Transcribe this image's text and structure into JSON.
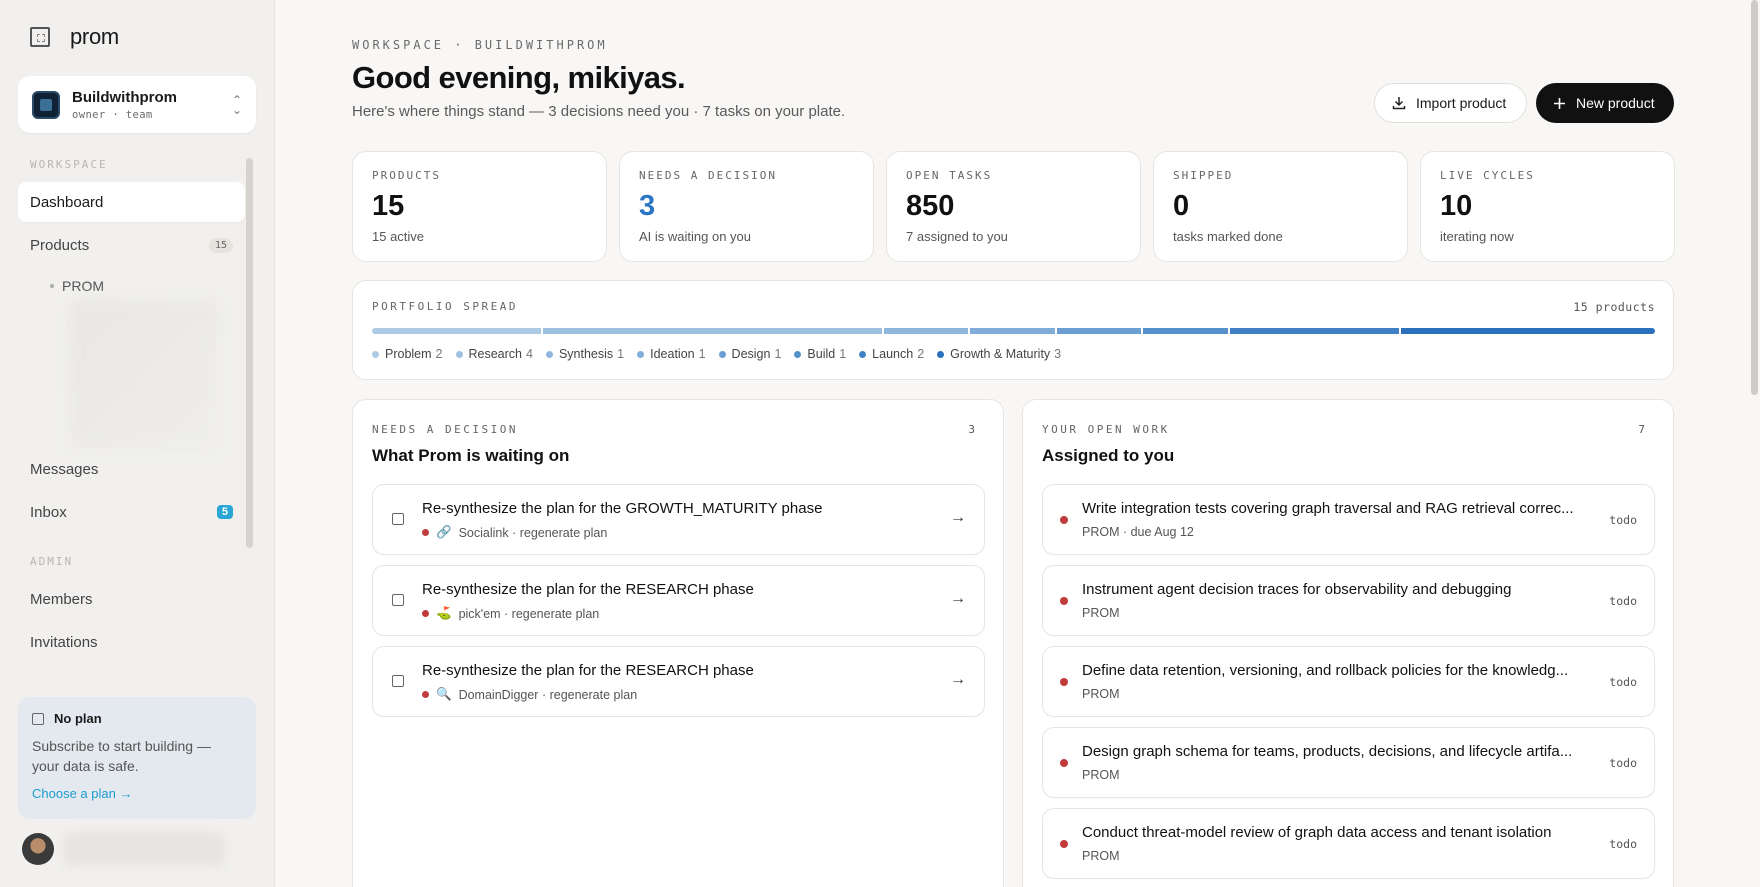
{
  "brand": {
    "name": "prom"
  },
  "workspace": {
    "name": "Buildwithprom",
    "role": "owner · team"
  },
  "sidebar": {
    "section_workspace": "WORKSPACE",
    "dashboard": "Dashboard",
    "products": {
      "label": "Products",
      "count": "15"
    },
    "product_item": "PROM",
    "messages": "Messages",
    "inbox": {
      "label": "Inbox",
      "badge": "5"
    },
    "section_admin": "ADMIN",
    "members": "Members",
    "invitations": "Invitations"
  },
  "plan": {
    "title": "No plan",
    "desc": "Subscribe to start building — your data is safe.",
    "link": "Choose a plan →"
  },
  "header": {
    "eyebrow": "WORKSPACE · BUILDWITHPROM",
    "greeting": "Good evening, mikiyas.",
    "subline": "Here's where things stand — 3 decisions need you · 7 tasks on your plate.",
    "import_label": "Import product",
    "new_label": "New product"
  },
  "stats": [
    {
      "label": "PRODUCTS",
      "value": "15",
      "sub": "15 active"
    },
    {
      "label": "NEEDS A DECISION",
      "value": "3",
      "sub": "AI is waiting on you"
    },
    {
      "label": "OPEN TASKS",
      "value": "850",
      "sub": "7 assigned to you"
    },
    {
      "label": "SHIPPED",
      "value": "0",
      "sub": "tasks marked done"
    },
    {
      "label": "LIVE CYCLES",
      "value": "10",
      "sub": "iterating now"
    }
  ],
  "portfolio": {
    "title": "PORTFOLIO SPREAD",
    "count": "15 products",
    "phases": [
      {
        "name": "Problem",
        "count": 2,
        "color": "#aecbe5"
      },
      {
        "name": "Research",
        "count": 4,
        "color": "#9ec0e0"
      },
      {
        "name": "Synthesis",
        "count": 1,
        "color": "#8fb6dd"
      },
      {
        "name": "Ideation",
        "count": 1,
        "color": "#7facd8"
      },
      {
        "name": "Design",
        "count": 1,
        "color": "#6b9fd2"
      },
      {
        "name": "Build",
        "count": 1,
        "color": "#5590cb"
      },
      {
        "name": "Launch",
        "count": 2,
        "color": "#3f81c4"
      },
      {
        "name": "Growth & Maturity",
        "count": 3,
        "color": "#2a70bd"
      }
    ]
  },
  "decisions": {
    "eyebrow": "NEEDS A DECISION",
    "count": "3",
    "title": "What Prom is waiting on",
    "items": [
      {
        "title": "Re-synthesize the plan for the GROWTH_MATURITY phase",
        "emoji": "🔗",
        "meta": "Socialink · regenerate plan"
      },
      {
        "title": "Re-synthesize the plan for the RESEARCH phase",
        "emoji": "⛳",
        "meta": "pick'em · regenerate plan"
      },
      {
        "title": "Re-synthesize the plan for the RESEARCH phase",
        "emoji": "🔍",
        "meta": "DomainDigger · regenerate plan"
      }
    ]
  },
  "work": {
    "eyebrow": "YOUR OPEN WORK",
    "count": "7",
    "title": "Assigned to you",
    "items": [
      {
        "title": "Write integration tests covering graph traversal and RAG retrieval correc...",
        "meta": "PROM · due Aug 12",
        "status": "todo"
      },
      {
        "title": "Instrument agent decision traces for observability and debugging",
        "meta": "PROM",
        "status": "todo"
      },
      {
        "title": "Define data retention, versioning, and rollback policies for the knowledg...",
        "meta": "PROM",
        "status": "todo"
      },
      {
        "title": "Design graph schema for teams, products, decisions, and lifecycle artifa...",
        "meta": "PROM",
        "status": "todo"
      },
      {
        "title": "Conduct threat-model review of graph data access and tenant isolation",
        "meta": "PROM",
        "status": "todo"
      }
    ]
  }
}
